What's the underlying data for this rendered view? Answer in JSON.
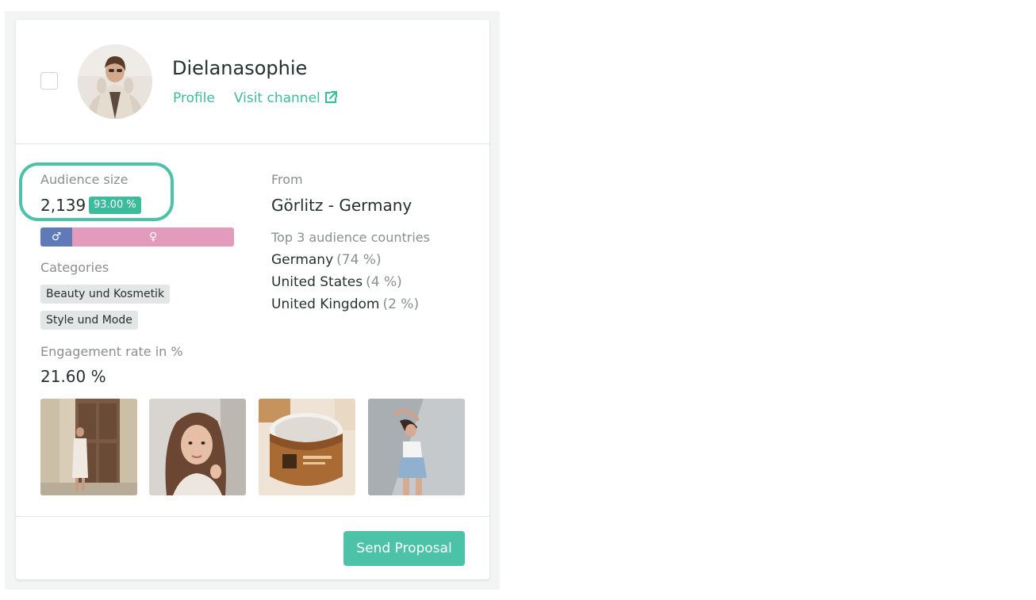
{
  "influencer": {
    "name": "Dielanasophie",
    "profile_link": "Profile",
    "visit_channel_link": "Visit channel"
  },
  "audience": {
    "label": "Audience size",
    "value": "2,139",
    "badge": "93.00 %",
    "gender": {
      "male_share": 0.165,
      "female_share": 0.835,
      "male_symbol": "♂",
      "female_symbol": "♀"
    }
  },
  "categories": {
    "label": "Categories",
    "items": [
      "Beauty und Kosmetik",
      "Style und Mode"
    ]
  },
  "engagement": {
    "label": "Engagement rate in %",
    "value": "21.60 %"
  },
  "location": {
    "label": "From",
    "value": "Görlitz - Germany"
  },
  "top_countries": {
    "label": "Top 3 audience countries",
    "items": [
      {
        "country": "Germany",
        "pct": "(74 %)"
      },
      {
        "country": "United States",
        "pct": "(4 %)"
      },
      {
        "country": "United Kingdom",
        "pct": "(2 %)"
      }
    ]
  },
  "actions": {
    "send_proposal": "Send Proposal"
  },
  "colors": {
    "accent": "#3dbb9d",
    "male": "#6079b8",
    "female": "#e29abd"
  }
}
